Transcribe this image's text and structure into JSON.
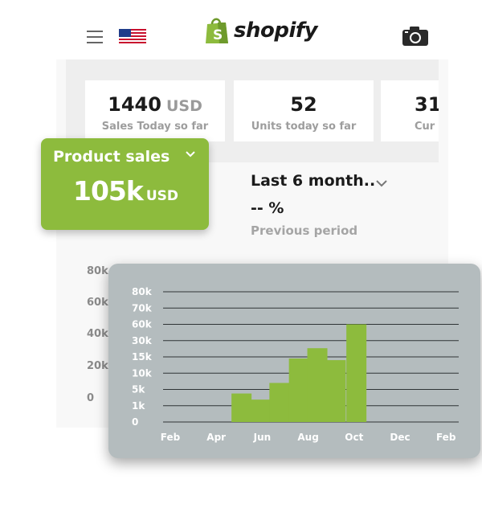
{
  "header": {
    "menu_icon": "hamburger-menu-icon",
    "flag_icon": "us-flag-icon",
    "logo_text": "shopify",
    "camera_icon": "camera-icon"
  },
  "stats": [
    {
      "value": "1440",
      "unit": "USD",
      "label": "Sales Today so far"
    },
    {
      "value": "52",
      "unit": "",
      "label": "Units today so far"
    },
    {
      "value": "31",
      "unit": "",
      "label": "Cur"
    }
  ],
  "product_card": {
    "title": "Product sales",
    "value": "105k",
    "unit": "USD",
    "color": "#8dbb3d"
  },
  "period": {
    "selected": "Last 6 month..",
    "change": "-- %",
    "label": "Previous period"
  },
  "background_axis": {
    "ticks": [
      "80k",
      "60k",
      "40k",
      "20k",
      "0"
    ]
  },
  "chart_data": {
    "type": "bar",
    "y_ticks": [
      "80k",
      "70k",
      "60k",
      "30k",
      "15k",
      "10k",
      "5k",
      "1k",
      "0"
    ],
    "x_ticks": [
      "Feb",
      "Apr",
      "Jun",
      "Aug",
      "Oct",
      "Dec",
      "Feb"
    ],
    "bar_color": "#8dbb3d",
    "background": "#b4bcbe",
    "bars": [
      {
        "x": 5.1,
        "value": 4
      },
      {
        "x": 5.95,
        "value": 2.5
      },
      {
        "x": 6.75,
        "value": 7
      },
      {
        "x": 7.6,
        "value": 14.5
      },
      {
        "x": 8.4,
        "value": 23
      },
      {
        "x": 9.2,
        "value": 14
      },
      {
        "x": 10.1,
        "value": 60
      }
    ]
  }
}
